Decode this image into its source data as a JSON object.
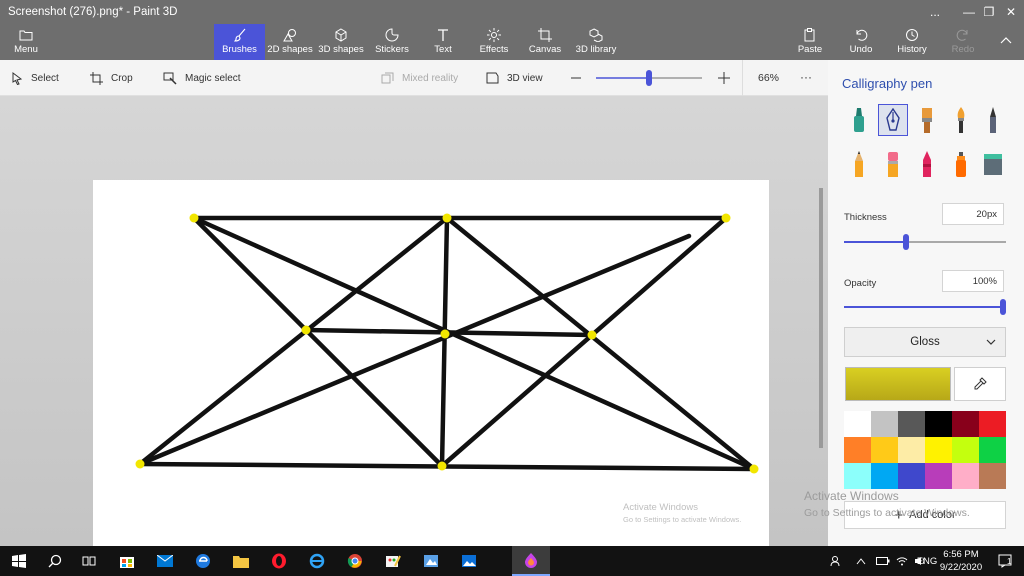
{
  "window": {
    "title": "Screenshot (276).png* - Paint 3D",
    "controls": [
      "...",
      "—",
      "❐",
      "✕"
    ]
  },
  "ribbon": {
    "menu_label": "Menu",
    "tools": [
      {
        "label": "Brushes",
        "icon": "brush-icon",
        "active": true
      },
      {
        "label": "2D shapes",
        "icon": "2d-shapes-icon"
      },
      {
        "label": "3D shapes",
        "icon": "3d-shapes-icon"
      },
      {
        "label": "Stickers",
        "icon": "stickers-icon"
      },
      {
        "label": "Text",
        "icon": "text-icon"
      },
      {
        "label": "Effects",
        "icon": "effects-icon"
      },
      {
        "label": "Canvas",
        "icon": "canvas-icon"
      },
      {
        "label": "3D library",
        "icon": "3d-library-icon"
      }
    ],
    "right": [
      {
        "label": "Paste",
        "icon": "paste-icon"
      },
      {
        "label": "Undo",
        "icon": "undo-icon"
      },
      {
        "label": "History",
        "icon": "history-icon"
      },
      {
        "label": "Redo",
        "icon": "redo-icon",
        "disabled": true
      }
    ]
  },
  "subbar": {
    "select": "Select",
    "crop": "Crop",
    "magic_select": "Magic select",
    "mixed_reality": "Mixed reality",
    "view_3d": "3D view",
    "zoom_value": 0.5,
    "zoom_percent": "66%",
    "more": "···"
  },
  "canvas": {
    "line_color": "#111111",
    "point_color": "#f2e600",
    "watermark_title": "Activate Windows",
    "watermark_sub": "Go to Settings to activate Windows."
  },
  "panel": {
    "title": "Calligraphy pen",
    "brushes": [
      {
        "name": "marker",
        "icon": "marker-icon"
      },
      {
        "name": "calligraphy-pen",
        "icon": "calligraphy-pen-icon",
        "active": true
      },
      {
        "name": "oil-brush",
        "icon": "oil-brush-icon"
      },
      {
        "name": "watercolor",
        "icon": "watercolor-icon"
      },
      {
        "name": "pixel-pen",
        "icon": "pixel-pen-icon"
      },
      {
        "name": "pencil",
        "icon": "pencil-icon"
      },
      {
        "name": "eraser",
        "icon": "eraser-icon"
      },
      {
        "name": "crayon",
        "icon": "crayon-icon"
      },
      {
        "name": "spray-can",
        "icon": "spray-can-icon"
      },
      {
        "name": "fill",
        "icon": "fill-bucket-icon"
      }
    ],
    "thickness_label": "Thickness",
    "thickness_value": "20px",
    "thickness_level": 0.38,
    "opacity_label": "Opacity",
    "opacity_value": "100%",
    "opacity_level": 1.0,
    "finish": "Gloss",
    "current_color": "#d9cf22",
    "palette": [
      "#ffffff",
      "#c3c3c3",
      "#585858",
      "#000000",
      "#88001b",
      "#ec1c24",
      "#ff7f27",
      "#ffca18",
      "#fdeca6",
      "#fff200",
      "#c4ff0e",
      "#0ed145",
      "#8cfffb",
      "#00a8f3",
      "#3f48cc",
      "#b83dba",
      "#ffaec8",
      "#b97a56"
    ],
    "add_color": "Add color",
    "activate_title": "Activate Windows",
    "activate_sub": "Go to Settings to activate Windows."
  },
  "taskbar": {
    "apps": [
      "windows-start-icon",
      "search-icon",
      "task-view-icon",
      "store-icon",
      "mail-icon",
      "edge-icon",
      "file-explorer-icon",
      "opera-icon",
      "internet-explorer-icon",
      "chrome-icon",
      "paint-icon",
      "pixel-app-icon",
      "photos-icon",
      "paint-3d-icon"
    ],
    "language": "ENG",
    "time": "6:56 PM",
    "date": "9/22/2020",
    "notification_count": "1"
  }
}
